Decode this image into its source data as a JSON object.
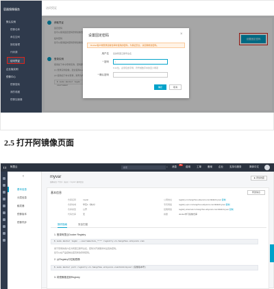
{
  "shot1": {
    "sidebar": {
      "brand": "容器镜像服务",
      "items": [
        {
          "label": "默认实例",
          "group": true
        },
        {
          "label": "镜像仓库"
        },
        {
          "label": "命名空间"
        },
        {
          "label": "授权管理"
        },
        {
          "label": "代码源"
        },
        {
          "label": "访问凭证",
          "active": true
        },
        {
          "label": "企业版实例",
          "group": true
        },
        {
          "label": "镜像中心",
          "group": true
        },
        {
          "label": "镜像搜索"
        },
        {
          "label": "我的收藏"
        },
        {
          "label": "镜像加速器"
        }
      ]
    },
    "header_title": "访问凭证",
    "content": {
      "step1_title": "获取凭证",
      "step1_sub1": "固定密码",
      "step1_sub1_desc": "您可以使用固定密码登录镜像仓库，建议定期更新。",
      "step1_sub2": "临时密码",
      "step1_sub2_desc": "您可以使用临时密码登录镜像仓库，有效期为1小时。",
      "step2_title": "登录实例",
      "step2_desc": "使用如下命令登录实例，密码即为上述获取的凭证。",
      "step2_line1": "(1) 登录实例镜像，建议使用docker客户端。",
      "step2_line2": "(2) 使用如下命令登录，账号为阿里云账号全名。",
      "cmd": "$ sudo docker login --username=",
      "set_password_button": "设置固定密码"
    },
    "modal": {
      "title": "设置固定密码",
      "close": "×",
      "warning": "Docker客户端登录镜像仓库时使用的密码，为保证安全，请定期修改密码。",
      "username_label": "用户名",
      "username_value": "您的阿里云账号全名",
      "password_label": "* 密码",
      "password_value": "|",
      "password_hint": "8-32位，必须包含字母、符号或数字中的至少两项",
      "confirm_label": "* 确认密码",
      "ok_label": "确定",
      "cancel_label": "取消"
    }
  },
  "heading": "2.5 打开阿镜像页面",
  "shot2": {
    "topbar": {
      "logo": "(-)",
      "brand": "阿里云",
      "search_placeholder": "搜索",
      "badge": "99+",
      "nav": [
        "消息",
        "费用",
        "工单",
        "备案",
        "企业",
        "支持与服务",
        "简体中文"
      ]
    },
    "subnav": {
      "back": "‹",
      "items": [
        {
          "label": "基本信息",
          "active": true
        },
        {
          "label": "分层信息"
        },
        {
          "label": "触发器"
        },
        {
          "label": "镜像版本"
        },
        {
          "label": "镜像同步"
        }
      ]
    },
    "repo_title": "myvar",
    "breadcrumb": "镜像仓库 / 华东1（杭州）/ myvar / 基本信息",
    "favorite_button": "★ 添加收藏",
    "card": {
      "title": "基本信息",
      "edit_button": "修改信息",
      "left_kv": [
        {
          "k": "仓库名称",
          "v": "myvar"
        },
        {
          "k": "仓库地域",
          "v": "华东1（杭州）"
        },
        {
          "k": "仓库类型",
          "v": "公开"
        },
        {
          "k": "代码仓库",
          "v": "无"
        }
      ],
      "right_kv": [
        {
          "k": "公网地址",
          "v": "registry.cn-hangzhou.aliyuncs.com/kkkk/myvar",
          "copy": "复制"
        },
        {
          "k": "专有网络",
          "v": "registry-vpc.cn-hangzhou.aliyuncs.com/kkkk/myvar",
          "copy": "复制"
        },
        {
          "k": "经典网络",
          "v": "registry-internal.cn-hangzhou.aliyuncs.com/kkkk/myvar",
          "copy": "复制"
        },
        {
          "k": "摘要",
          "v": "docker学习镜像仓库",
          "copy": ""
        }
      ],
      "tabs": [
        "操作指南",
        "安全扫描"
      ],
      "section1": "1. 登录阿里云Docker Registry",
      "code1": "$ sudo docker login --username=ice_**** registry.cn-hangzhou.aliyuncs.com",
      "note1": "用于登录的用户名为阿里云账号全名，密码为开通服务时设置的密码。",
      "note2": "您可以在产品控制台首页修改登录密码。",
      "section2": "2. 从Registry中拉取镜像",
      "code2": "$ sudo docker pull registry.cn-hangzhou.aliyuncs.com/kkkk/myvar:[镜像版本号]",
      "section3": "3. 将镜像推送到Registry"
    }
  }
}
